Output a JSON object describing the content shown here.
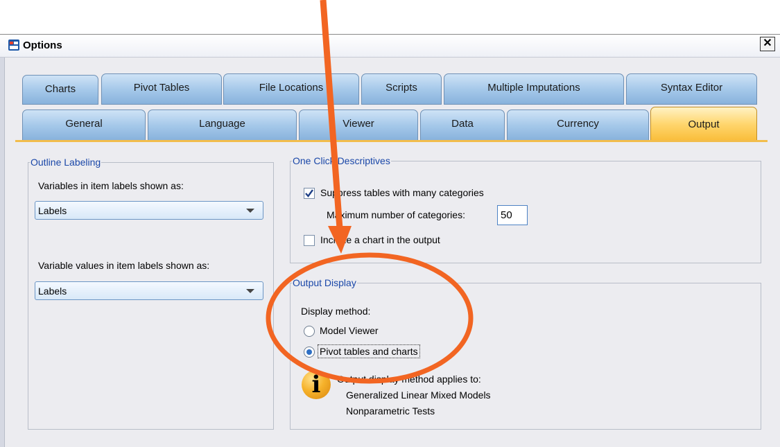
{
  "window": {
    "title": "Options",
    "close_label": "✕"
  },
  "tabs": {
    "row1": [
      "Charts",
      "Pivot Tables",
      "File Locations",
      "Scripts",
      "Multiple Imputations",
      "Syntax Editor"
    ],
    "row2": [
      "General",
      "Language",
      "Viewer",
      "Data",
      "Currency",
      "Output"
    ],
    "active": "Output"
  },
  "outline_labeling": {
    "legend": "Outline Labeling",
    "variables_label": "Variables in item labels shown as:",
    "variables_value": "Labels",
    "values_label": "Variable values in item labels shown as:",
    "values_value": "Labels"
  },
  "one_click": {
    "legend": "One Click Descriptives",
    "suppress_label": "Suppress tables with many categories",
    "suppress_checked": true,
    "max_label": "Maximum number of categories:",
    "max_value": "50",
    "include_chart_label": "Include a chart in the output",
    "include_chart_checked": false
  },
  "output_display": {
    "legend": "Output Display",
    "method_label": "Display method:",
    "option_model_viewer": "Model Viewer",
    "option_pivot": "Pivot tables and charts",
    "selected": "Pivot tables and charts",
    "info_line1": "Output display method applies to:",
    "info_line2": "Generalized Linear Mixed Models",
    "info_line3": "Nonparametric Tests"
  },
  "colors": {
    "annotation": "#f26522",
    "active_tab": "#f9bd3a",
    "tab": "#a6c9ea"
  },
  "icons": {
    "app": "spss-options-icon",
    "info": "info-icon",
    "check": "checkmark-icon"
  }
}
